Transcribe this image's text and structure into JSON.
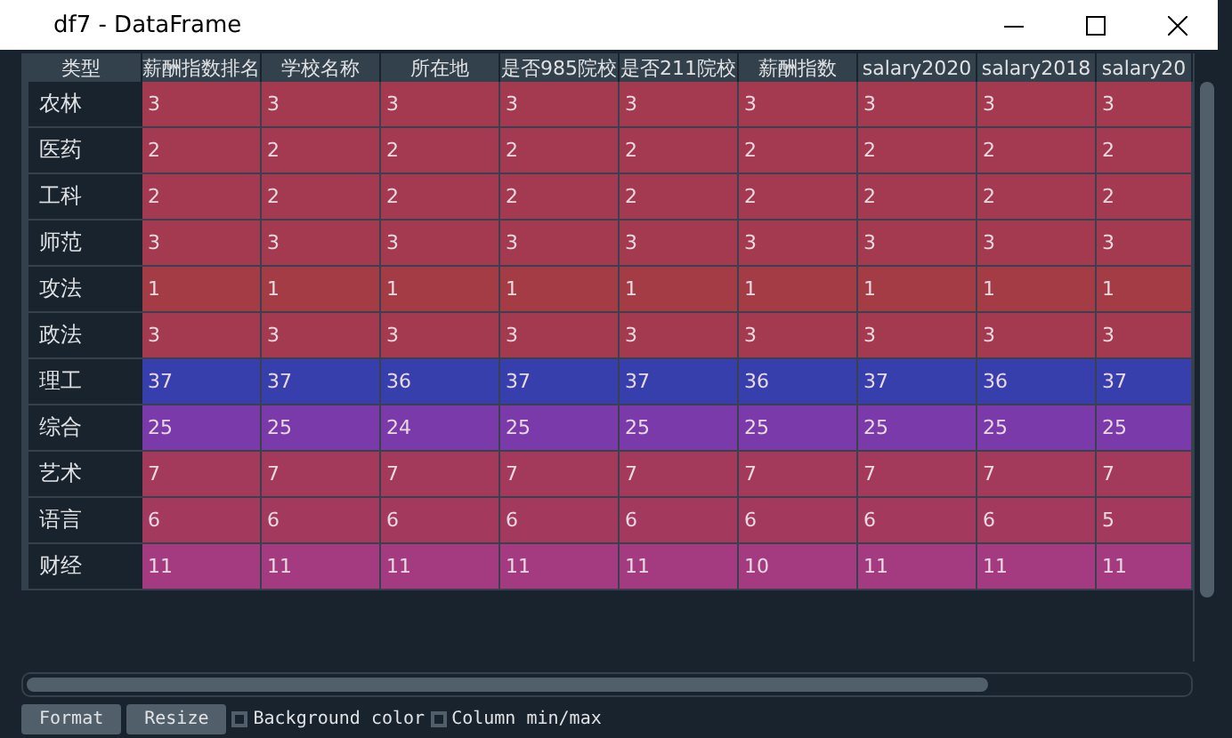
{
  "window": {
    "title": "df7 - DataFrame"
  },
  "table": {
    "index_header": "类型",
    "columns": [
      "薪酬指数排名",
      "学校名称",
      "所在地",
      "是否985院校",
      "是否211院校",
      "薪酬指数",
      "salary2020",
      "salary2018",
      "salary20"
    ],
    "rows": [
      {
        "label": "农林",
        "color": "#a33a50",
        "cells": [
          "3",
          "3",
          "3",
          "3",
          "3",
          "3",
          "3",
          "3",
          "3"
        ]
      },
      {
        "label": "医药",
        "color": "#a33a52",
        "cells": [
          "2",
          "2",
          "2",
          "2",
          "2",
          "2",
          "2",
          "2",
          "2"
        ]
      },
      {
        "label": "工科",
        "color": "#a33a52",
        "cells": [
          "2",
          "2",
          "2",
          "2",
          "2",
          "2",
          "2",
          "2",
          "2"
        ]
      },
      {
        "label": "师范",
        "color": "#a33a50",
        "cells": [
          "3",
          "3",
          "3",
          "3",
          "3",
          "3",
          "3",
          "3",
          "3"
        ]
      },
      {
        "label": "攻法",
        "color": "#a43c46",
        "cells": [
          "1",
          "1",
          "1",
          "1",
          "1",
          "1",
          "1",
          "1",
          "1"
        ]
      },
      {
        "label": "政法",
        "color": "#a33a50",
        "cells": [
          "3",
          "3",
          "3",
          "3",
          "3",
          "3",
          "3",
          "3",
          "3"
        ]
      },
      {
        "label": "理工",
        "color": "#373fac",
        "cells": [
          "37",
          "37",
          "36",
          "37",
          "37",
          "36",
          "37",
          "36",
          "37"
        ]
      },
      {
        "label": "综合",
        "color": "#7a3aaa",
        "cells": [
          "25",
          "25",
          "24",
          "25",
          "25",
          "25",
          "25",
          "25",
          "25"
        ]
      },
      {
        "label": "艺术",
        "color": "#a33a5c",
        "cells": [
          "7",
          "7",
          "7",
          "7",
          "7",
          "7",
          "7",
          "7",
          "7"
        ]
      },
      {
        "label": "语言",
        "color": "#a33a5e",
        "cells": [
          "6",
          "6",
          "6",
          "6",
          "6",
          "6",
          "6",
          "6",
          "5"
        ]
      },
      {
        "label": "财经",
        "color": "#a43a80",
        "cells": [
          "11",
          "11",
          "11",
          "11",
          "11",
          "10",
          "11",
          "11",
          "11"
        ]
      }
    ]
  },
  "buttons": [
    "Format",
    "Resize"
  ],
  "checkboxes": [
    {
      "label": "Background color",
      "checked": false
    },
    {
      "label": "Column min/max",
      "checked": false
    }
  ]
}
